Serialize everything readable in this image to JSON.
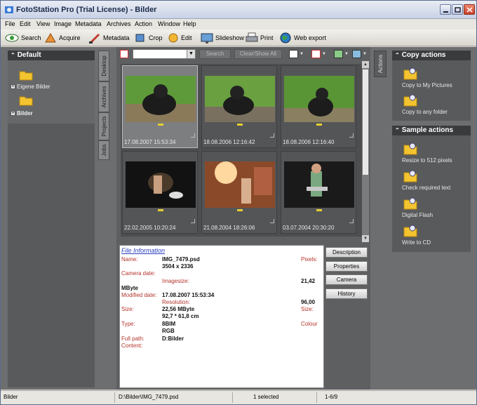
{
  "window": {
    "title": "FotoStation Pro (Trial License) - Bilder"
  },
  "menu": [
    "File",
    "Edit",
    "View",
    "Image",
    "Metadata",
    "Archives",
    "Action",
    "Window",
    "Help"
  ],
  "toolbar": {
    "search": "Search",
    "acquire": "Acquire",
    "metadata": "Metadata",
    "crop": "Crop",
    "edit": "Edit",
    "slideshow": "Slideshow",
    "print": "Print",
    "web_export": "Web export"
  },
  "left_panel": {
    "header": "Default",
    "items": [
      "Eigene Bilder",
      "Bilder"
    ]
  },
  "vertical_tabs": [
    "Desktop",
    "Archives",
    "Projects",
    "Jobs"
  ],
  "center_toolbar": {
    "search_button": "Search",
    "clear_button": "Clear/Show All"
  },
  "thumbnails": [
    {
      "date": "17.08.2007 15:53:34"
    },
    {
      "date": "18.08.2006 12:16:42"
    },
    {
      "date": "18.08.2006 12:16:40"
    },
    {
      "date": "22.02.2005 10:20:24"
    },
    {
      "date": "21.08.2004 18:26:06"
    },
    {
      "date": "03.07.2004 20:30:20"
    }
  ],
  "info": {
    "title": "File Information",
    "name_label": "Name:",
    "name_value": "IMG_7479.psd",
    "pixels_label": "Pixels:",
    "pixels_value": "3504 x 2336",
    "camera_date_label": "Camera date:",
    "imagesize_label": "Imagesize:",
    "imagesize_value": "21,42",
    "mbyte": "MByte",
    "modified_label": "Modified date:",
    "modified_value": "17.08.2007 15:53:34",
    "resolution_label": "Resolution:",
    "resolution_value": "96,00",
    "size_label": "Size:",
    "size_value": "22,56 MByte",
    "size_label2": "Size:",
    "dims_value": "92,7 * 61,8 cm",
    "type_label": "Type:",
    "type_value": "8BIM",
    "colour_label": "Colour",
    "colour_value": "RGB",
    "fullpath_label": "Full path:",
    "fullpath_value": "D:Bilder",
    "content_label": "Content:"
  },
  "info_buttons": [
    "Description",
    "Properties",
    "Camera",
    "History"
  ],
  "actions_tab": "Actions",
  "copy_actions": {
    "header": "Copy actions",
    "items": [
      "Copy to My Pictures",
      "Copy to any folder"
    ]
  },
  "sample_actions": {
    "header": "Sample actions",
    "items": [
      "Resize to 512 pixels",
      "Check required text",
      "Digital Flash",
      "Write to CD"
    ]
  },
  "status": {
    "folder": "Bilder",
    "path": "D:\\Bilder\\IMG_7479.psd",
    "selected": "1 selected",
    "range": "1-6/9"
  },
  "colors": {
    "accent_red": "#b3332a",
    "link_blue": "#2a3fbf"
  }
}
